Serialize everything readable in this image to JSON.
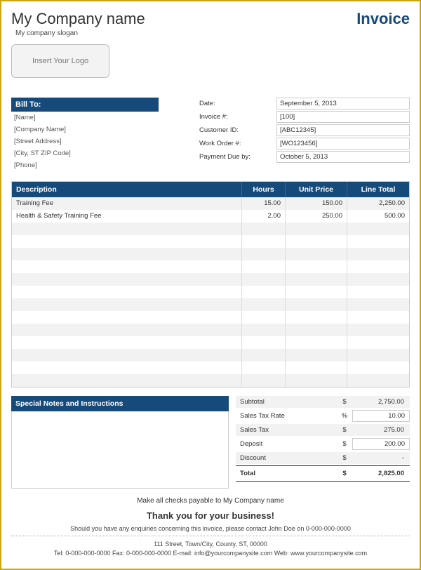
{
  "header": {
    "company_name": "My Company name",
    "slogan": "My company slogan",
    "title": "Invoice",
    "logo_placeholder": "Insert Your Logo"
  },
  "billto": {
    "header": "Bill To:",
    "lines": [
      "[Name]",
      "[Company Name]",
      "[Street Address]",
      "[City, ST  ZIP Code]",
      "[Phone]"
    ]
  },
  "meta": [
    {
      "label": "Date:",
      "value": "September 5, 2013"
    },
    {
      "label": "Invoice #:",
      "value": "[100]"
    },
    {
      "label": "Customer ID:",
      "value": "[ABC12345]"
    },
    {
      "label": "Work Order #:",
      "value": "[WO123456]"
    },
    {
      "label": "Payment Due by:",
      "value": "October 5, 2013"
    }
  ],
  "items": {
    "columns": {
      "desc": "Description",
      "hours": "Hours",
      "price": "Unit Price",
      "total": "Line Total"
    },
    "rows": [
      {
        "desc": "Training Fee",
        "hours": "15.00",
        "price": "150.00",
        "total": "2,250.00"
      },
      {
        "desc": "Health & Safety Training Fee",
        "hours": "2.00",
        "price": "250.00",
        "total": "500.00"
      },
      {
        "desc": "",
        "hours": "",
        "price": "",
        "total": ""
      },
      {
        "desc": "",
        "hours": "",
        "price": "",
        "total": ""
      },
      {
        "desc": "",
        "hours": "",
        "price": "",
        "total": ""
      },
      {
        "desc": "",
        "hours": "",
        "price": "",
        "total": ""
      },
      {
        "desc": "",
        "hours": "",
        "price": "",
        "total": ""
      },
      {
        "desc": "",
        "hours": "",
        "price": "",
        "total": ""
      },
      {
        "desc": "",
        "hours": "",
        "price": "",
        "total": ""
      },
      {
        "desc": "",
        "hours": "",
        "price": "",
        "total": ""
      },
      {
        "desc": "",
        "hours": "",
        "price": "",
        "total": ""
      },
      {
        "desc": "",
        "hours": "",
        "price": "",
        "total": ""
      },
      {
        "desc": "",
        "hours": "",
        "price": "",
        "total": ""
      },
      {
        "desc": "",
        "hours": "",
        "price": "",
        "total": ""
      },
      {
        "desc": "",
        "hours": "",
        "price": "",
        "total": ""
      }
    ]
  },
  "notes_header": "Special Notes and Instructions",
  "totals": {
    "subtotal_label": "Subtotal",
    "subtotal_sym": "$",
    "subtotal_val": "2,750.00",
    "taxrate_label": "Sales Tax Rate",
    "taxrate_sym": "%",
    "taxrate_val": "10.00",
    "tax_label": "Sales Tax",
    "tax_sym": "$",
    "tax_val": "275.00",
    "deposit_label": "Deposit",
    "deposit_sym": "$",
    "deposit_val": "200.00",
    "discount_label": "Discount",
    "discount_sym": "$",
    "discount_val": "-",
    "total_label": "Total",
    "total_sym": "$",
    "total_val": "2,825.00"
  },
  "footer": {
    "payable": "Make all checks payable to My Company name",
    "thanks": "Thank you for your business!",
    "enquiries": "Should you have any enquiries concerning this invoice, please contact John Doe on 0-000-000-0000",
    "contact1": "111 Street, Town/City, County, ST, 00000",
    "contact2": "Tel: 0-000-000-0000 Fax: 0-000-000-0000 E-mail: info@yourcompanysite.com Web: www.yourcompanysite.com"
  }
}
